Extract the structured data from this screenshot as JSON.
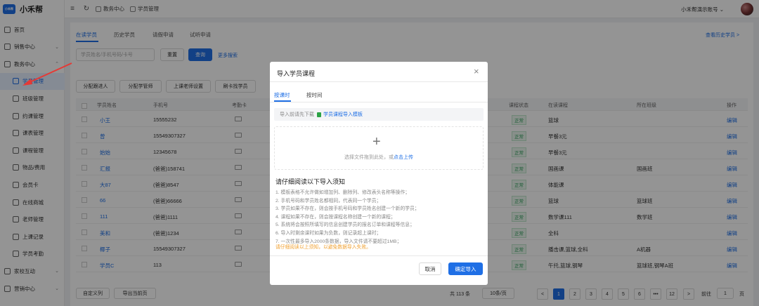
{
  "brand": {
    "logo_text": "小禾帮",
    "name": "小禾帮"
  },
  "sidebar": {
    "items": [
      {
        "label": "首页",
        "icon": "home-icon"
      },
      {
        "label": "销售中心",
        "icon": "sales-icon",
        "chevron": "⌄"
      },
      {
        "label": "教务中心",
        "icon": "teaching-icon",
        "chevron": "⌃"
      },
      {
        "label": "学员管理",
        "icon": "student-icon"
      },
      {
        "label": "班级管理",
        "icon": "class-icon"
      },
      {
        "label": "约课管理",
        "icon": "booking-icon"
      },
      {
        "label": "课表管理",
        "icon": "schedule-icon"
      },
      {
        "label": "课程管理",
        "icon": "course-icon"
      },
      {
        "label": "物品/费用",
        "icon": "goods-icon"
      },
      {
        "label": "会员卡",
        "icon": "card-icon"
      },
      {
        "label": "在线商城",
        "icon": "shop-icon"
      },
      {
        "label": "老师管理",
        "icon": "teacher-icon"
      },
      {
        "label": "上课记录",
        "icon": "record-icon"
      },
      {
        "label": "学员考勤",
        "icon": "attendance-icon"
      },
      {
        "label": "家校互动",
        "icon": "interaction-icon",
        "chevron": "⌄"
      },
      {
        "label": "营销中心",
        "icon": "marketing-icon",
        "chevron": "⌄"
      }
    ]
  },
  "topbar": {
    "menu_icon": "≡",
    "refresh_icon": "↻",
    "breadcrumb": [
      "教务中心",
      "学员管理"
    ],
    "account": "小禾帮演示账号 ⌄"
  },
  "main": {
    "tabs": [
      "在读学员",
      "历史学员",
      "请假申请",
      "试听申请"
    ],
    "history_link": "查看历史学员 >",
    "search_placeholder": "学员姓名/手机号码/卡号",
    "reset": "重置",
    "search": "查询",
    "more": "更多搜索",
    "actions": [
      "分配跟进人",
      "分配学管师",
      "上课老师设置",
      "刷卡找学员"
    ],
    "columns": [
      "学员姓名",
      "手机号",
      "考勤卡",
      "课程状态",
      "在读课程",
      "所在班级",
      "操作"
    ],
    "rows": [
      {
        "name": "小王",
        "phone": "15555232",
        "status": "正常",
        "course": "篮球",
        "class": "",
        "op": "编辑"
      },
      {
        "name": "曾",
        "phone": "15549307327",
        "status": "正常",
        "course": "早餐3元",
        "class": "",
        "op": "编辑"
      },
      {
        "name": "始始",
        "phone": "12345678",
        "status": "正常",
        "course": "早餐3元",
        "class": "",
        "op": "编辑"
      },
      {
        "name": "汇报",
        "phone": "(爸爸)158741",
        "status": "正常",
        "course": "国画课",
        "class": "国画班",
        "op": "编辑"
      },
      {
        "name": "大87",
        "phone": "(爸爸)8547",
        "status": "正常",
        "course": "体能课",
        "class": "",
        "op": "编辑"
      },
      {
        "name": "66",
        "phone": "(爸爸)66666",
        "status": "正常",
        "course": "篮球",
        "class": "篮球班",
        "op": "编辑"
      },
      {
        "name": "111",
        "phone": "(爸爸)1111",
        "status": "正常",
        "course": "数学课111",
        "class": "数学班",
        "op": "编辑"
      },
      {
        "name": "美和",
        "phone": "(爸爸)1234",
        "status": "正常",
        "course": "全科",
        "class": "",
        "op": "编辑"
      },
      {
        "name": "椰子",
        "phone": "15549307327",
        "status": "正常",
        "course": "播击课,篮球,全科",
        "class": "A机器",
        "op": "编辑"
      },
      {
        "name": "学员C",
        "phone": "113",
        "status": "正常",
        "course": "午托,篮球,钢琴",
        "class": "篮球班,钢琴A班",
        "op": "编辑"
      }
    ],
    "footer_buttons": [
      "自定义列",
      "导出当前页"
    ],
    "total": "共 113 条",
    "page_size": "10条/页",
    "pages": [
      "<",
      "1",
      "2",
      "3",
      "4",
      "5",
      "6",
      "•••",
      "12",
      ">"
    ],
    "goto_label": "前往",
    "goto_value": "1",
    "goto_unit": "页"
  },
  "dialog": {
    "title": "导入学员课程",
    "close": "×",
    "tabs": [
      "按课时",
      "按时间"
    ],
    "notice_prefix": "导入前请先下载",
    "notice_link": "学员课程导入模板",
    "plus": "+",
    "drop_text": "选择文件拖到此处，或",
    "drop_link": "点击上传",
    "rules_title": "请仔细阅读以下导入须知",
    "rules": [
      "1. 模板表格不允许做如增加列、删除列、修改表头名称等操作；",
      "2. 手机号码和学员姓名都相同，代表同一个学员；",
      "3. 学员如果不存在，则会按手机号码和学员姓名创建一个新的学员；",
      "4. 课程如果不存在，则会按课程名称创建一个新的课程；",
      "5. 系统将会按照所填写的信息创建学员的报名订单和课程等信息；",
      "6. 导入时剩余课时如果为负数，则记录超上课时；",
      "7. 一次性最多导入2000条数据，导入文件请不要超过1MB；"
    ],
    "warning": "请仔细阅读以上须知，以避免数据导入失败。",
    "cancel": "取消",
    "confirm": "确定导入"
  },
  "colors": {
    "primary": "#1f6fe5",
    "annotation_arrow": "#e53935"
  }
}
